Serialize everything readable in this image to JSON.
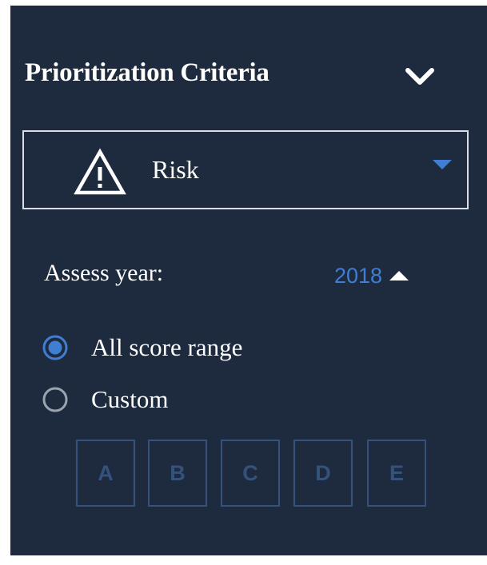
{
  "panel": {
    "title": "Prioritization Criteria",
    "collapse_icon": "chevron-down-icon"
  },
  "criteria_select": {
    "icon": "warning-icon",
    "value": "Risk",
    "dropdown_icon": "caret-down-icon"
  },
  "assess_year": {
    "label": "Assess year:",
    "value": "2018",
    "toggle_icon": "caret-up-icon"
  },
  "score_range": {
    "options": [
      {
        "label": "All score range",
        "selected": true
      },
      {
        "label": "Custom",
        "selected": false
      }
    ],
    "grades": [
      "A",
      "B",
      "C",
      "D",
      "E"
    ]
  },
  "colors": {
    "panel_bg": "#1e2b3f",
    "accent": "#3f7ed0",
    "disabled": "#34527c",
    "text": "#ffffff"
  }
}
